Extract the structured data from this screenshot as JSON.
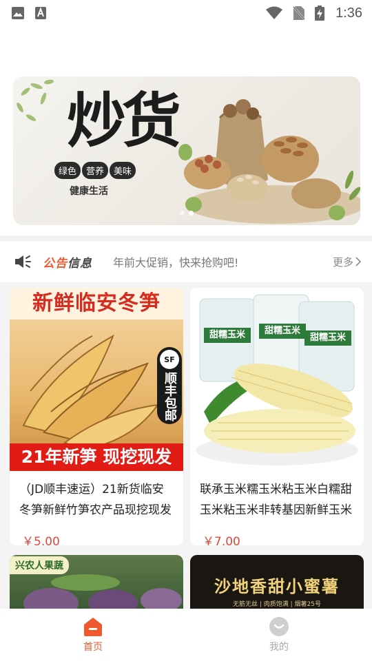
{
  "status_bar": {
    "time": "1:36"
  },
  "banner": {
    "headline": "炒货",
    "tags": [
      "绿色",
      "营养",
      "美味"
    ],
    "subtitle": "健康生活",
    "slide_count": 2,
    "active_slide": 1
  },
  "notice": {
    "title_highlight": "公告",
    "title_rest": "信息",
    "message": "年前大促销，快来抢购吧!",
    "more": "更多"
  },
  "products": [
    {
      "image_top_text": "新鲜临安冬笋",
      "image_badge": "顺丰包邮",
      "image_badge_logo": "SF",
      "image_bottom_text": "21年新笋 现挖现发",
      "name": "（JD顺丰速运）21新货临安冬笋新鲜竹笋农产品现挖现发",
      "price": "￥5.00"
    },
    {
      "image_pack_label": "甜糯玉米",
      "name": "联承玉米糯玉米粘玉米白糯甜玉米粘玉米非转基因新鲜玉米",
      "price": "￥7.00"
    },
    {
      "image_top_text": "兴农人果蔬"
    },
    {
      "image_top_text": "沙地香甜小蜜薯",
      "image_sub_text": "无筋无丝 | 肉质饱满 | 烟薯25号"
    }
  ],
  "tabbar": {
    "items": [
      {
        "label": "首页",
        "active": true
      },
      {
        "label": "我的",
        "active": false
      }
    ]
  },
  "colors": {
    "accent": "#f0582f",
    "price": "#e0463b"
  }
}
